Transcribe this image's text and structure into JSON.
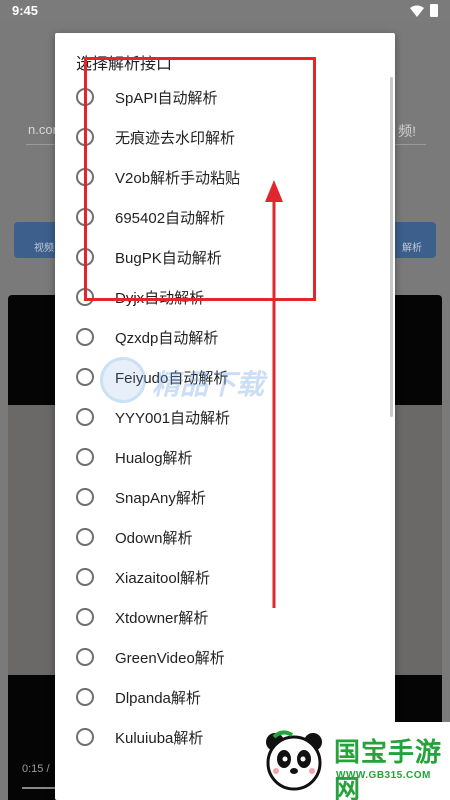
{
  "status_bar": {
    "time": "9:45"
  },
  "background_app": {
    "url_fragment": "n.con",
    "input_tail": "频!",
    "button_left_label": "视频",
    "button_right_label": "解析",
    "video_time": "0:15 /"
  },
  "dialog": {
    "title": "选择解析接口",
    "options": [
      {
        "label": "SpAPI自动解析"
      },
      {
        "label": "无痕迹去水印解析"
      },
      {
        "label": "V2ob解析手动粘贴"
      },
      {
        "label": "695402自动解析"
      },
      {
        "label": "BugPK自动解析"
      },
      {
        "label": "Dyjx自动解析"
      },
      {
        "label": "Qzxdp自动解析"
      },
      {
        "label": "Feiyudo自动解析"
      },
      {
        "label": "YYY001自动解析"
      },
      {
        "label": "Hualog解析"
      },
      {
        "label": "SnapAny解析"
      },
      {
        "label": "Odown解析"
      },
      {
        "label": "Xiazaitool解析"
      },
      {
        "label": "Xtdowner解析"
      },
      {
        "label": "GreenVideo解析"
      },
      {
        "label": "Dlpanda解析"
      },
      {
        "label": "Kuluiuba解析"
      }
    ]
  },
  "watermark": {
    "text": "精品下载"
  },
  "brand": {
    "title": "国宝手游网",
    "url": "WWW.GB315.COM"
  },
  "colors": {
    "annotation": "#e2262d",
    "brand_green": "#24a33a"
  }
}
